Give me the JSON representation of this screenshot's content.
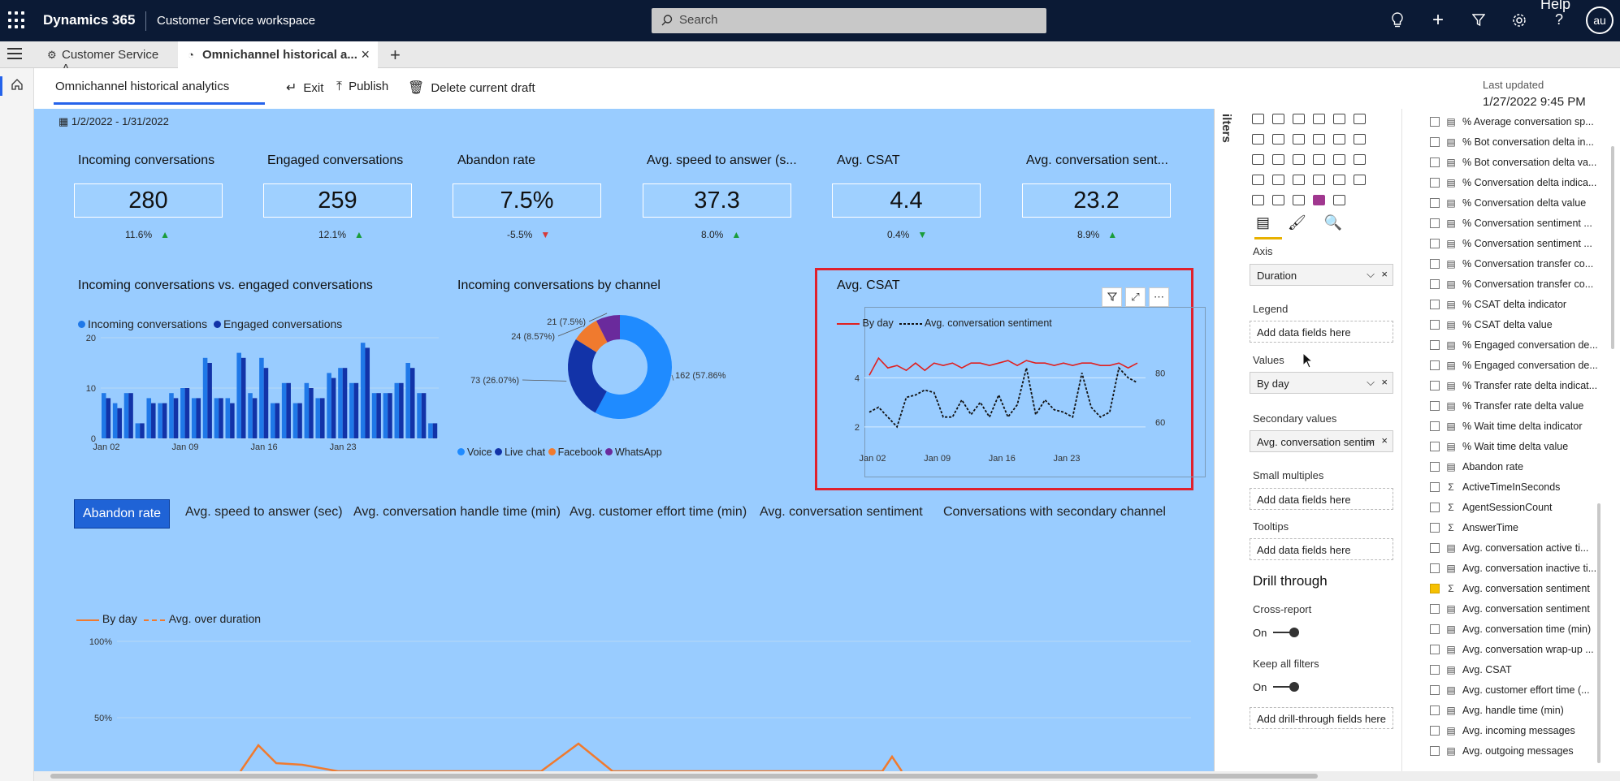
{
  "topbar": {
    "brand": "Dynamics 365",
    "app_name": "Customer Service workspace",
    "search_placeholder": "Search",
    "help_label": "Help",
    "user_initials": "au"
  },
  "tabs": [
    {
      "label": "Customer Service A..."
    },
    {
      "label": "Omnichannel historical a..."
    }
  ],
  "commandbar": {
    "page_title": "Omnichannel historical analytics",
    "exit": "Exit",
    "publish": "Publish",
    "delete_draft": "Delete current draft",
    "last_updated_label": "Last updated",
    "last_updated_value": "1/27/2022 9:45 PM"
  },
  "report": {
    "date_range": "1/2/2022 - 1/31/2022",
    "kpis": [
      {
        "title": "Incoming conversations",
        "value": "280",
        "delta": "11.6%",
        "dir": "up"
      },
      {
        "title": "Engaged conversations",
        "value": "259",
        "delta": "12.1%",
        "dir": "up"
      },
      {
        "title": "Abandon rate",
        "value": "7.5%",
        "delta": "-5.5%",
        "dir": "down"
      },
      {
        "title": "Avg. speed to answer (s...",
        "value": "37.3",
        "delta": "8.0%",
        "dir": "up"
      },
      {
        "title": "Avg. CSAT",
        "value": "4.4",
        "delta": "0.4%",
        "dir": "down-green"
      },
      {
        "title": "Avg. conversation sent...",
        "value": "23.2",
        "delta": "8.9%",
        "dir": "up"
      }
    ],
    "bar_section": {
      "title": "Incoming conversations vs. engaged conversations",
      "legend_incoming": "Incoming conversations",
      "legend_engaged": "Engaged conversations"
    },
    "donut_section": {
      "title": "Incoming conversations by channel",
      "legend": [
        "Voice",
        "Live chat",
        "Facebook",
        "WhatsApp"
      ]
    },
    "csat_section": {
      "title": "Avg. CSAT",
      "legend_by_day": "By day",
      "legend_sentiment": "Avg. conversation sentiment"
    },
    "tab_buttons": [
      "Abandon rate",
      "Avg. speed to answer (sec)",
      "Avg. conversation handle time (min)",
      "Avg. customer effort time (min)",
      "Avg. conversation sentiment",
      "Conversations with secondary channel"
    ],
    "bottom_section": {
      "legend_by_day": "By day",
      "legend_avg": "Avg. over duration"
    }
  },
  "chart_data": [
    {
      "type": "bar",
      "title": "Incoming conversations vs. engaged conversations",
      "ylim": [
        0,
        20
      ],
      "yticks": [
        "0",
        "10",
        "20"
      ],
      "xticks": [
        "Jan 02",
        "Jan 09",
        "Jan 16",
        "Jan 23"
      ],
      "series": [
        {
          "name": "Incoming conversations",
          "values": [
            9,
            7,
            9,
            3,
            8,
            7,
            9,
            10,
            8,
            16,
            8,
            8,
            17,
            9,
            16,
            7,
            11,
            7,
            11,
            8,
            13,
            14,
            11,
            19,
            9,
            9,
            11,
            15,
            9,
            3
          ]
        },
        {
          "name": "Engaged conversations",
          "values": [
            8,
            6,
            9,
            3,
            7,
            7,
            8,
            10,
            8,
            15,
            8,
            7,
            16,
            8,
            14,
            7,
            11,
            7,
            10,
            8,
            12,
            14,
            11,
            18,
            9,
            9,
            11,
            14,
            9,
            3
          ]
        }
      ],
      "colors": {
        "incoming": "#1f78e8",
        "engaged": "#1233a8"
      }
    },
    {
      "type": "pie",
      "title": "Incoming conversations by channel",
      "labels": [
        "Voice",
        "Live chat",
        "Facebook",
        "WhatsApp"
      ],
      "values": [
        162,
        73,
        24,
        21
      ],
      "data_labels": [
        "162 (57.86%)",
        "73 (26.07%)",
        "24 (8.57%)",
        "21 (7.5%)"
      ],
      "colors": [
        "#1f8bff",
        "#1233a8",
        "#f07a2e",
        "#6a2a9c"
      ]
    },
    {
      "type": "line",
      "title": "Avg. CSAT",
      "xticks": [
        "Jan 02",
        "Jan 09",
        "Jan 16",
        "Jan 23"
      ],
      "y_left_ticks": [
        "2",
        "4"
      ],
      "y_right_ticks": [
        "60",
        "80"
      ],
      "ylim_left": [
        1.4,
        5.2
      ],
      "ylim_right": [
        52,
        90
      ],
      "series": [
        {
          "name": "By day",
          "axis": "left",
          "values": [
            4.1,
            4.8,
            4.4,
            4.5,
            4.3,
            4.6,
            4.3,
            4.6,
            4.5,
            4.6,
            4.4,
            4.6,
            4.6,
            4.5,
            4.6,
            4.7,
            4.5,
            4.7,
            4.6,
            4.6,
            4.5,
            4.6,
            4.5,
            4.6,
            4.6,
            4.5,
            4.5,
            4.6,
            4.4,
            4.6
          ]
        },
        {
          "name": "Avg. conversation sentiment",
          "axis": "right",
          "values": [
            64,
            66,
            62,
            58,
            70,
            71,
            73,
            72,
            62,
            62,
            69,
            63,
            68,
            62,
            71,
            62,
            67,
            82,
            63,
            69,
            65,
            64,
            62,
            80,
            66,
            62,
            64,
            82,
            78,
            76
          ]
        }
      ]
    },
    {
      "type": "line",
      "title": "",
      "yticks": [
        "100%",
        "50%"
      ],
      "series": [
        {
          "name": "By day"
        },
        {
          "name": "Avg. over duration"
        }
      ]
    }
  ],
  "viz_pane": {
    "axis_label": "Axis",
    "axis_value": "Duration",
    "legend_label": "Legend",
    "legend_value": "Add data fields here",
    "values_label": "Values",
    "values_value": "By day",
    "secondary_label": "Secondary values",
    "secondary_value": "Avg. conversation sentim",
    "small_multiples_label": "Small multiples",
    "small_multiples_value": "Add data fields here",
    "tooltips_label": "Tooltips",
    "tooltips_value": "Add data fields here",
    "drill_through": "Drill through",
    "cross_report_label": "Cross-report",
    "cross_report_state": "On",
    "keep_filters_label": "Keep all filters",
    "keep_filters_state": "On",
    "drill_fields_value": "Add drill-through fields here",
    "filters_label": "ilters"
  },
  "fields": [
    {
      "label": "% Average conversation sp...",
      "type": "calc",
      "checked": false
    },
    {
      "label": "% Bot conversation delta in...",
      "type": "calc",
      "checked": false
    },
    {
      "label": "% Bot conversation delta va...",
      "type": "calc",
      "checked": false
    },
    {
      "label": "% Conversation delta indica...",
      "type": "calc",
      "checked": false
    },
    {
      "label": "% Conversation delta value",
      "type": "calc",
      "checked": false
    },
    {
      "label": "% Conversation sentiment ...",
      "type": "calc",
      "checked": false
    },
    {
      "label": "% Conversation sentiment ...",
      "type": "calc",
      "checked": false
    },
    {
      "label": "% Conversation transfer co...",
      "type": "calc",
      "checked": false
    },
    {
      "label": "% Conversation transfer co...",
      "type": "calc",
      "checked": false
    },
    {
      "label": "% CSAT delta indicator",
      "type": "calc",
      "checked": false
    },
    {
      "label": "% CSAT delta value",
      "type": "calc",
      "checked": false
    },
    {
      "label": "% Engaged conversation de...",
      "type": "calc",
      "checked": false
    },
    {
      "label": "% Engaged conversation de...",
      "type": "calc",
      "checked": false
    },
    {
      "label": "% Transfer rate delta indicat...",
      "type": "calc",
      "checked": false
    },
    {
      "label": "% Transfer rate delta value",
      "type": "calc",
      "checked": false
    },
    {
      "label": "% Wait time delta indicator",
      "type": "calc",
      "checked": false
    },
    {
      "label": "% Wait time delta value",
      "type": "calc",
      "checked": false
    },
    {
      "label": "Abandon rate",
      "type": "calc",
      "checked": false
    },
    {
      "label": "ActiveTimeInSeconds",
      "type": "sum",
      "checked": false
    },
    {
      "label": "AgentSessionCount",
      "type": "sum",
      "checked": false
    },
    {
      "label": "AnswerTime",
      "type": "sum",
      "checked": false
    },
    {
      "label": "Avg. conversation active ti...",
      "type": "calc",
      "checked": false
    },
    {
      "label": "Avg. conversation inactive ti...",
      "type": "calc",
      "checked": false
    },
    {
      "label": "Avg. conversation sentiment",
      "type": "sum",
      "checked": true
    },
    {
      "label": "Avg. conversation sentiment",
      "type": "calc",
      "checked": false
    },
    {
      "label": "Avg. conversation time (min)",
      "type": "calc",
      "checked": false
    },
    {
      "label": "Avg. conversation wrap-up ...",
      "type": "calc",
      "checked": false
    },
    {
      "label": "Avg. CSAT",
      "type": "calc",
      "checked": false
    },
    {
      "label": "Avg. customer effort time (...",
      "type": "calc",
      "checked": false
    },
    {
      "label": "Avg. handle time (min)",
      "type": "calc",
      "checked": false
    },
    {
      "label": "Avg. incoming messages",
      "type": "calc",
      "checked": false
    },
    {
      "label": "Avg. outgoing messages",
      "type": "calc",
      "checked": false
    }
  ]
}
